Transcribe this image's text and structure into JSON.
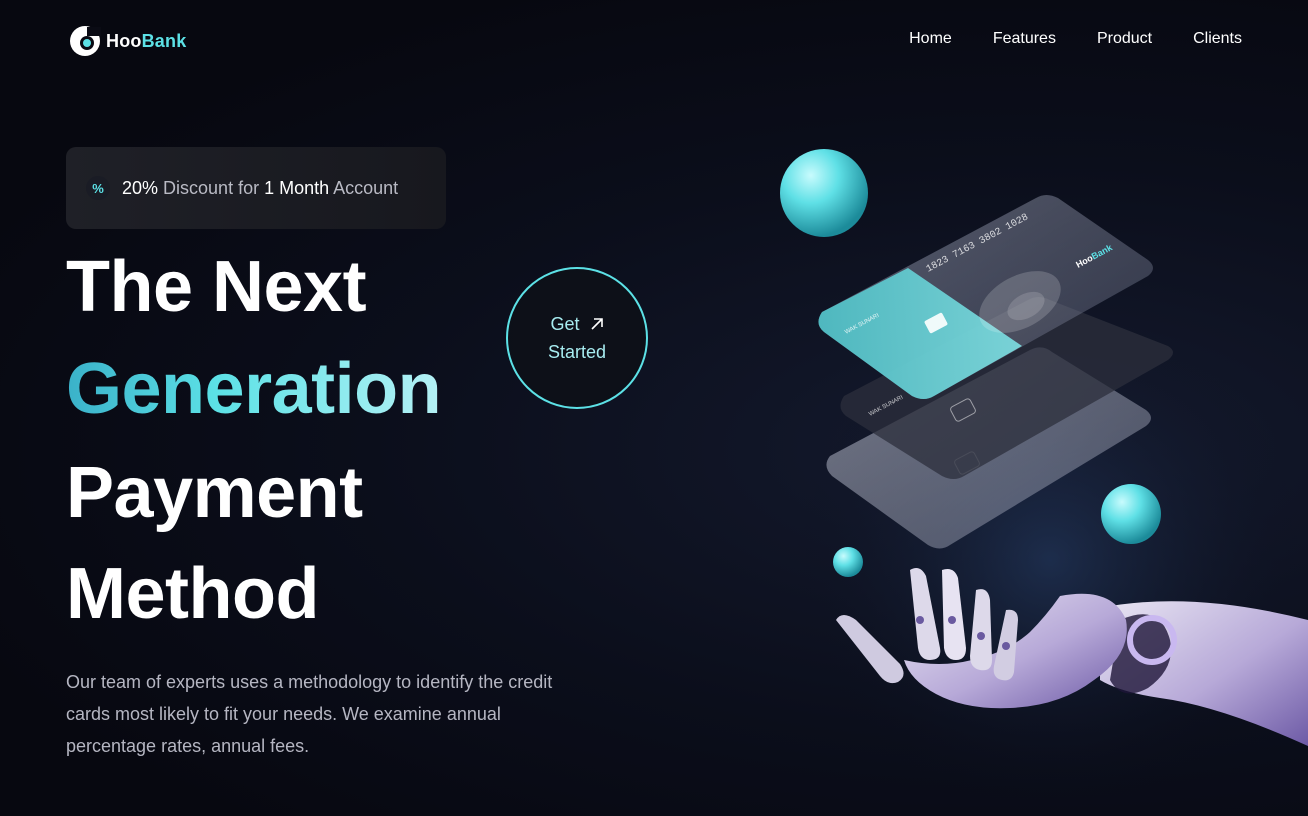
{
  "brand": {
    "name_part1": "Hoo",
    "name_part2": "Bank",
    "accent_color": "#5ce1e6"
  },
  "nav": {
    "items": [
      {
        "label": "Home"
      },
      {
        "label": "Features"
      },
      {
        "label": "Product"
      },
      {
        "label": "Clients"
      }
    ]
  },
  "badge": {
    "icon": "discount-icon",
    "discount": "20%",
    "text1": " Discount for ",
    "duration": "1 Month",
    "text2": " Account"
  },
  "hero": {
    "line1": "The Next",
    "line2": "Generation",
    "line3": "Payment",
    "line4": "Method",
    "description": "Our team of experts uses a methodology to identify the credit cards most likely to fit your needs. We examine annual percentage rates, annual fees."
  },
  "cta": {
    "line1": "Get",
    "line2": "Started",
    "icon": "arrow-up-right-icon"
  },
  "illustration": {
    "card_number": "1823 7163 3802 1028",
    "card_brand_part1": "Hoo",
    "card_brand_part2": "Bank",
    "card_holder": "WAK SUNARI",
    "icon": "robot-hand-cards-illustration"
  }
}
